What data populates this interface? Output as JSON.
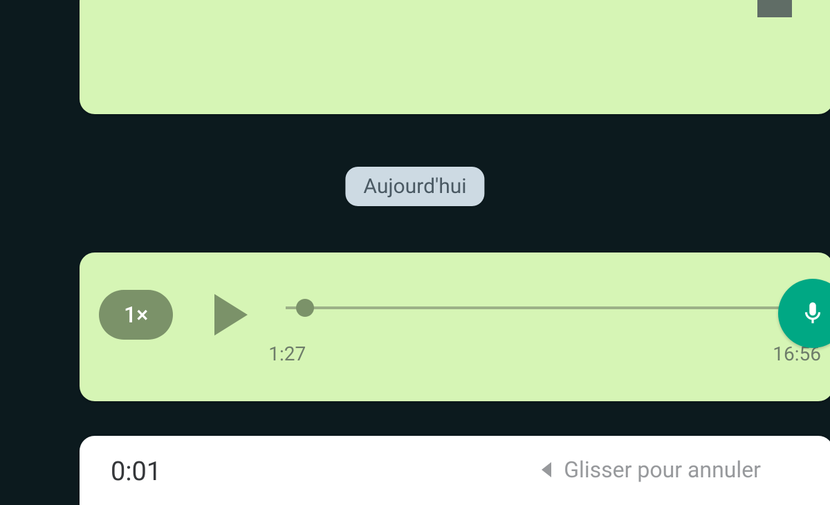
{
  "date_separator": "Aujourd'hui",
  "voice_message": {
    "speed_label": "1×",
    "duration": "1:27",
    "timestamp": "16:56"
  },
  "recording": {
    "timer": "0:01",
    "cancel_hint": "Glisser pour annuler"
  },
  "colors": {
    "background": "#0c1a1e",
    "bubble": "#d6f5b5",
    "date_pill": "#cddae3",
    "accent": "#00a884",
    "muted_green": "#7b9269"
  }
}
